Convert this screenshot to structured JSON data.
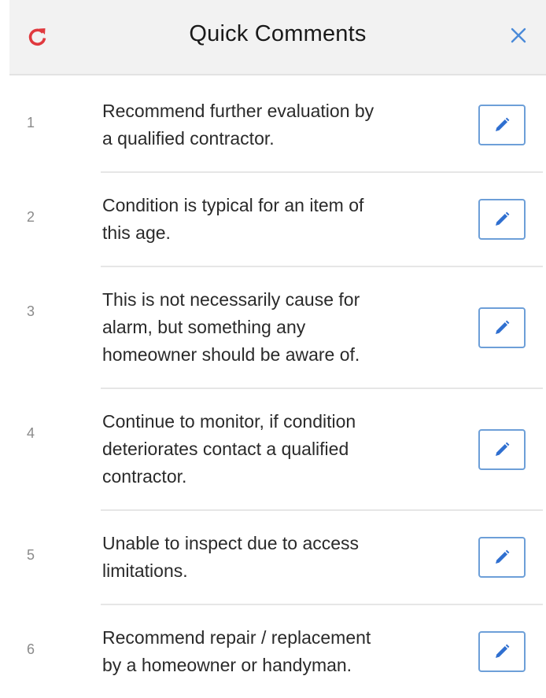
{
  "header": {
    "title": "Quick Comments",
    "refresh_icon": "refresh-icon",
    "close_icon": "close-icon",
    "refresh_color": "#e0393e",
    "close_color": "#4a8ad8"
  },
  "comments": [
    {
      "number": "1",
      "text": "Recommend further evaluation by\na qualified contractor."
    },
    {
      "number": "2",
      "text": "Condition is typical for an item of\nthis age."
    },
    {
      "number": "3",
      "text": "This is not necessarily cause for\nalarm, but something any\nhomeowner should be aware of."
    },
    {
      "number": "4",
      "text": "Continue to monitor, if condition\ndeteriorates contact a qualified\ncontractor."
    },
    {
      "number": "5",
      "text": "Unable to inspect due to access\nlimitations."
    },
    {
      "number": "6",
      "text": "Recommend repair / replacement\nby a homeowner or handyman."
    }
  ],
  "edit_icon": "pencil-icon",
  "accent_color": "#2f6fd0"
}
